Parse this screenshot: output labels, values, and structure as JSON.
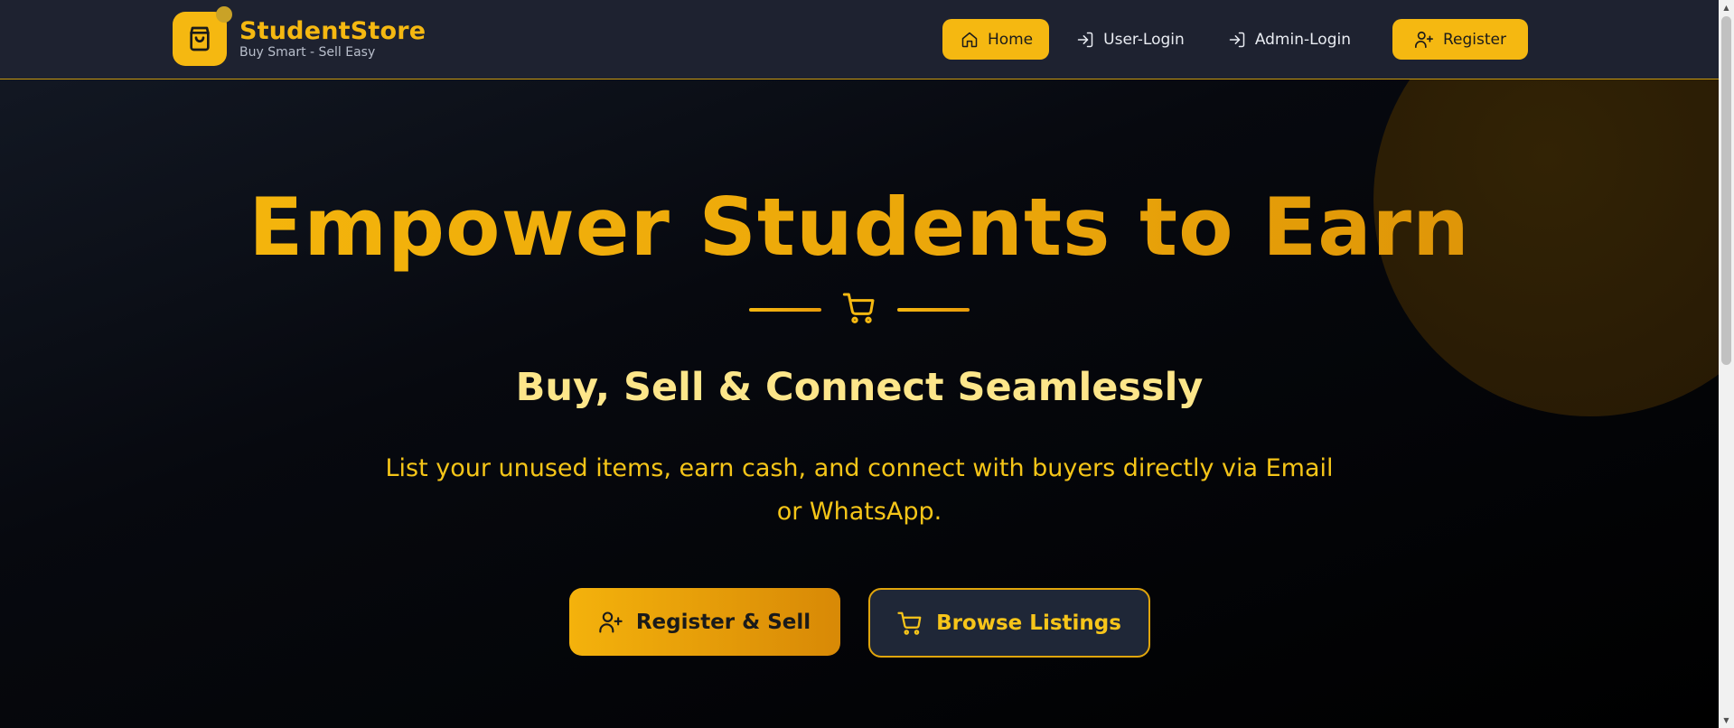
{
  "brand": {
    "name": "StudentStore",
    "tagline": "Buy Smart - Sell Easy",
    "logo_icon": "shopping-bag-icon",
    "accent_color": "#f5b811"
  },
  "nav": {
    "items": [
      {
        "label": "Home",
        "icon": "home-icon",
        "active": true
      },
      {
        "label": "User-Login",
        "icon": "login-icon"
      },
      {
        "label": "Admin-Login",
        "icon": "login-icon"
      },
      {
        "label": "Register",
        "icon": "user-plus-icon"
      }
    ]
  },
  "hero": {
    "title": "Empower Students to Earn",
    "divider_icon": "cart-icon",
    "subtitle": "Buy, Sell & Connect Seamlessly",
    "description": "List your unused items, earn cash, and connect with buyers directly via Email or WhatsApp.",
    "cta_primary": {
      "label": "Register & Sell",
      "icon": "user-plus-icon"
    },
    "cta_secondary": {
      "label": "Browse Listings",
      "icon": "cart-icon"
    }
  },
  "colors": {
    "navbar_bg": "#1e2230",
    "page_bg": "#000000",
    "subtitle": "#fde68a",
    "secondary_button_bg": "#1f2737"
  }
}
